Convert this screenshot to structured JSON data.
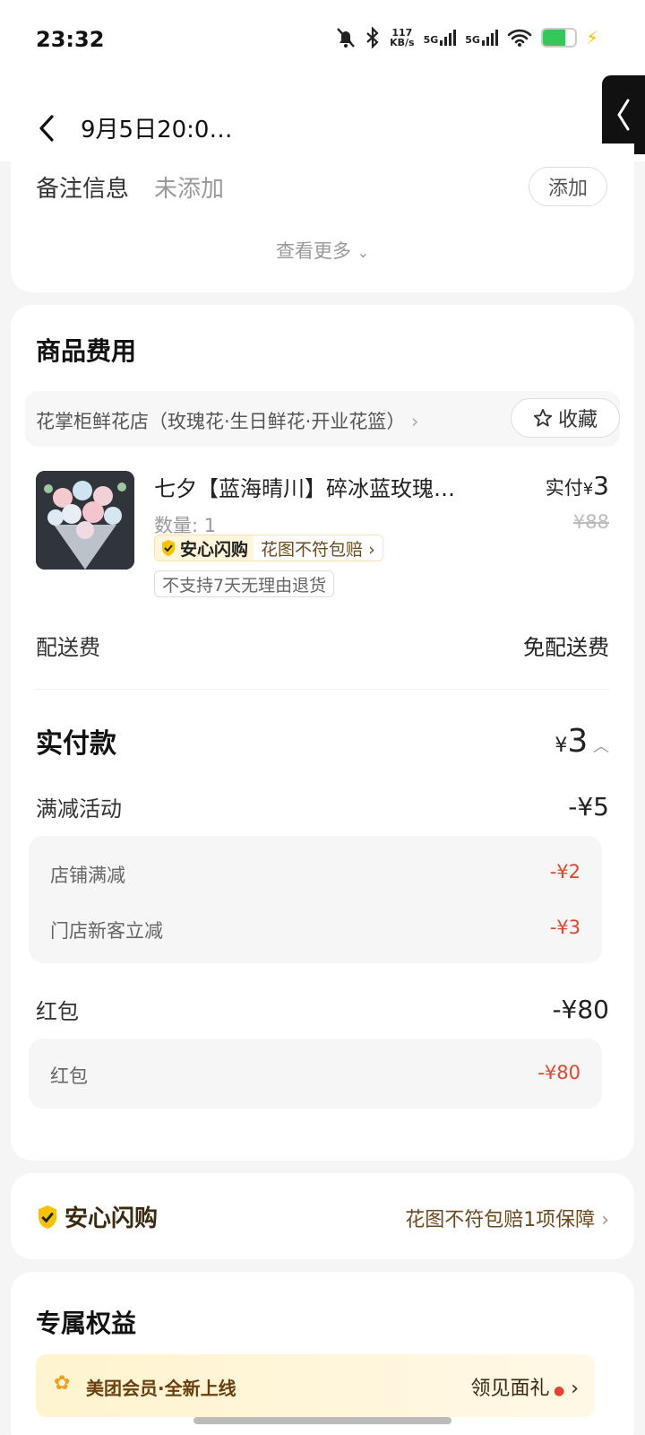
{
  "status_bar": {
    "time": "23:32",
    "net_speed_value": "117",
    "net_speed_unit": "KB/s",
    "sim1": "5G",
    "sim2": "5G",
    "battery_level": 0.7
  },
  "header": {
    "title": "9月5日20:0…"
  },
  "note": {
    "label": "备注信息",
    "value": "未添加",
    "add_label": "添加",
    "more_label": "查看更多"
  },
  "goods": {
    "section_title": "商品费用",
    "shop_name": "花掌柜鲜花店（玫瑰花·生日鲜花·开业花篮）",
    "fav_label": "收藏",
    "product": {
      "name": "七夕【蓝海晴川】碎冰蓝玫瑰…",
      "qty": "数量: 1",
      "paid_label": "实付",
      "currency": "¥",
      "paid_value": "3",
      "original": "¥88",
      "badge_main": "安心闪购",
      "badge_sub": "花图不符包赔",
      "no_return": "不支持7天无理由退货"
    },
    "delivery_label": "配送费",
    "delivery_value": "免配送费"
  },
  "payment": {
    "label": "实付款",
    "currency": "¥",
    "value": "3",
    "discount_label": "满减活动",
    "discount_value": "-¥5",
    "discount_items": [
      {
        "label": "店铺满减",
        "value": "-¥2"
      },
      {
        "label": "门店新客立减",
        "value": "-¥3"
      }
    ],
    "redpacket_label": "红包",
    "redpacket_value": "-¥80",
    "redpacket_items": [
      {
        "label": "红包",
        "value": "-¥80"
      }
    ]
  },
  "guarantee": {
    "title": "安心闪购",
    "text": "花图不符包赔1项保障"
  },
  "benefits": {
    "title": "专属权益",
    "promo_text": "美团会员·全新上线",
    "promo_action": "领见面礼"
  },
  "colors": {
    "accent_red": "#e5452f",
    "badge_gold": "#f7c300"
  }
}
